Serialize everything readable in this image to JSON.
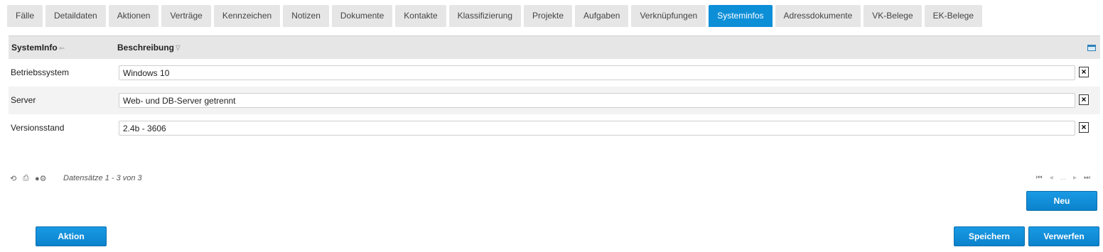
{
  "tabs": [
    {
      "label": "Fälle",
      "active": false
    },
    {
      "label": "Detaildaten",
      "active": false
    },
    {
      "label": "Aktionen",
      "active": false
    },
    {
      "label": "Verträge",
      "active": false
    },
    {
      "label": "Kennzeichen",
      "active": false
    },
    {
      "label": "Notizen",
      "active": false
    },
    {
      "label": "Dokumente",
      "active": false
    },
    {
      "label": "Kontakte",
      "active": false
    },
    {
      "label": "Klassifizierung",
      "active": false
    },
    {
      "label": "Projekte",
      "active": false
    },
    {
      "label": "Aufgaben",
      "active": false
    },
    {
      "label": "Verknüpfungen",
      "active": false
    },
    {
      "label": "Systeminfos",
      "active": true
    },
    {
      "label": "Adressdokumente",
      "active": false
    },
    {
      "label": "VK-Belege",
      "active": false
    },
    {
      "label": "EK-Belege",
      "active": false
    }
  ],
  "grid": {
    "columns": {
      "systeminfo": "SystemInfo",
      "beschreibung": "Beschreibung"
    },
    "rows": [
      {
        "label": "Betriebssystem",
        "value": "Windows 10"
      },
      {
        "label": "Server",
        "value": "Web- und DB-Server getrennt"
      },
      {
        "label": "Versionsstand",
        "value": "2.4b - 3606"
      }
    ],
    "delete_label": "×"
  },
  "footer": {
    "records": "Datensätze 1 - 3 von 3",
    "pager_ellipsis": "..."
  },
  "buttons": {
    "neu": "Neu",
    "aktion": "Aktion",
    "speichern": "Speichern",
    "verwerfen": "Verwerfen"
  },
  "colors": {
    "accent": "#0d8fd8",
    "tab_bg": "#e6e6e6",
    "header_bg": "#e6e6e6"
  }
}
